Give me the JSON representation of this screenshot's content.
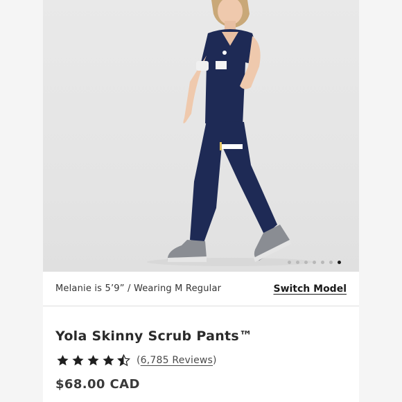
{
  "gallery": {
    "image_alt": "Model wearing navy scrub top and Yola Skinny Scrub Pants",
    "dot_count": 7,
    "active_index": 6
  },
  "model_info": {
    "text": "Melanie is 5’9” / Wearing M Regular",
    "switch_label": "Switch Model"
  },
  "product": {
    "title": "Yola Skinny Scrub Pants™",
    "rating": 4.5,
    "reviews_open": "(",
    "reviews_count_label": "6,785 Reviews",
    "reviews_close": ")",
    "price": "$68.00 CAD"
  },
  "colors": {
    "scrub_navy": "#1e2a55",
    "active_dot": "#1a1a1a",
    "star": "#1f1f1f"
  }
}
